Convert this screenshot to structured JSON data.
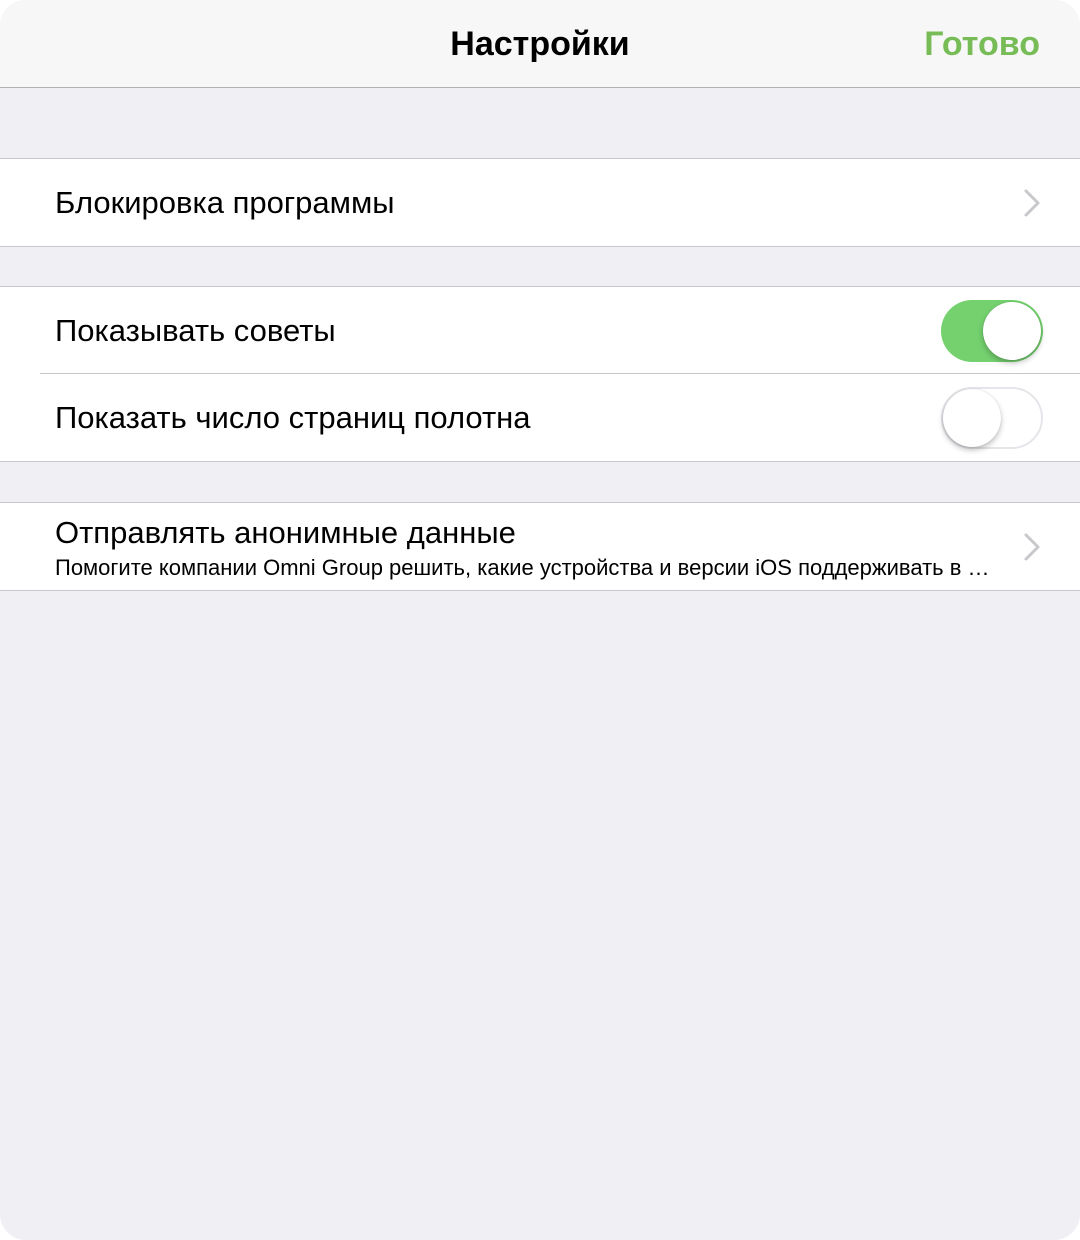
{
  "navbar": {
    "title": "Настройки",
    "done_label": "Готово"
  },
  "colors": {
    "accent": "#77bc56",
    "toggle_on": "#74d16e",
    "background": "#efeff4"
  },
  "sections": {
    "lock": {
      "label": "Блокировка программы",
      "icon": "chevron-right-icon"
    },
    "tips": {
      "label": "Показывать советы",
      "enabled": true
    },
    "page_count": {
      "label": "Показать число страниц полотна",
      "enabled": false
    },
    "anonymous": {
      "title": "Отправлять анонимные данные",
      "subtitle": "Помогите компании Omni Group решить, какие устройства и версии iOS поддерживать в будущем",
      "icon": "chevron-right-icon"
    }
  }
}
